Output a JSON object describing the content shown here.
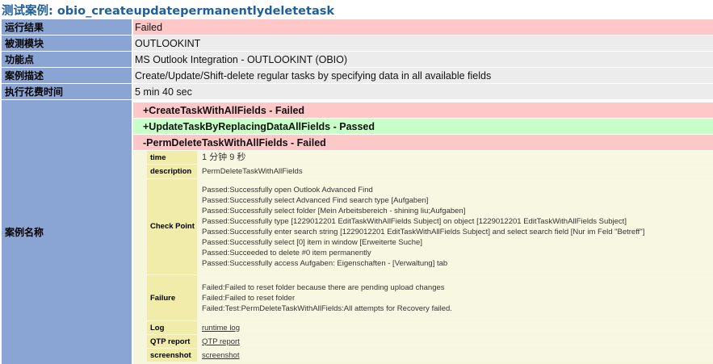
{
  "title": "测试案例: obio_createupdatepermanentlydeletetask",
  "summary": [
    {
      "label": "运行结果",
      "value": "Failed"
    },
    {
      "label": "被测模块",
      "value": "OUTLOOKINT"
    },
    {
      "label": "功能点",
      "value": "MS Outlook Integration - OUTLOOKINT (OBIO)"
    },
    {
      "label": "案例描述",
      "value": "Create/Update/Shift-delete regular tasks by specifying data in all available fields"
    },
    {
      "label": "执行花费时间",
      "value": "5 min 40 sec"
    }
  ],
  "case_name_label": "案例名称",
  "subtests": [
    {
      "label": "+CreateTaskWithAllFields - Failed",
      "status": "Failed"
    },
    {
      "label": "+UpdateTaskByReplacingDataAllFields - Passed",
      "status": "Passed"
    },
    {
      "label": "-PermDeleteTaskWithAllFields - Failed",
      "status": "Failed"
    }
  ],
  "detail": {
    "time_label": "time",
    "time_value": "1 分钟 9 秒",
    "description_label": "description",
    "description_value": "PermDeleteTaskWithAllFields",
    "checkpoint_label": "Check Point",
    "checkpoints": [
      "Passed:Successfully open Outlook Advanced Find",
      "Passed:Successfully select Advanced Find search type [Aufgaben]",
      "Passed:Successfully select folder [Mein Arbeitsbereich - shining liu;Aufgaben]",
      "Passed:Successfully type [1229012201 EditTaskWithAllFields Subject] on object [1229012201 EditTaskWithAllFields Subject]",
      "Passed:Successfully enter search string [1229012201 EditTaskWithAllFields Subject] and select search field [Nur im Feld \"Betreff\"]",
      "Passed:Successfully select [0] item in window [Erweiterte Suche]",
      "Passed:Succeeded to delete #0 item permanently",
      "Passed:Successfully access Aufgaben: Eigenschaften - [Verwaltung] tab"
    ],
    "failure_label": "Failure",
    "failures": [
      "Failed:Failed to reset folder because there are pending upload changes",
      "Failed:Failed to reset folder",
      "Failed:Test:PermDeleteTaskWithAllFields:All attempts for Recovery failed."
    ],
    "log_label": "Log",
    "log_link": "runtime log",
    "qtp_label": "QTP report",
    "qtp_link": "QTP report",
    "screenshot_label": "screenshot",
    "screenshot_link": "screenshot"
  }
}
